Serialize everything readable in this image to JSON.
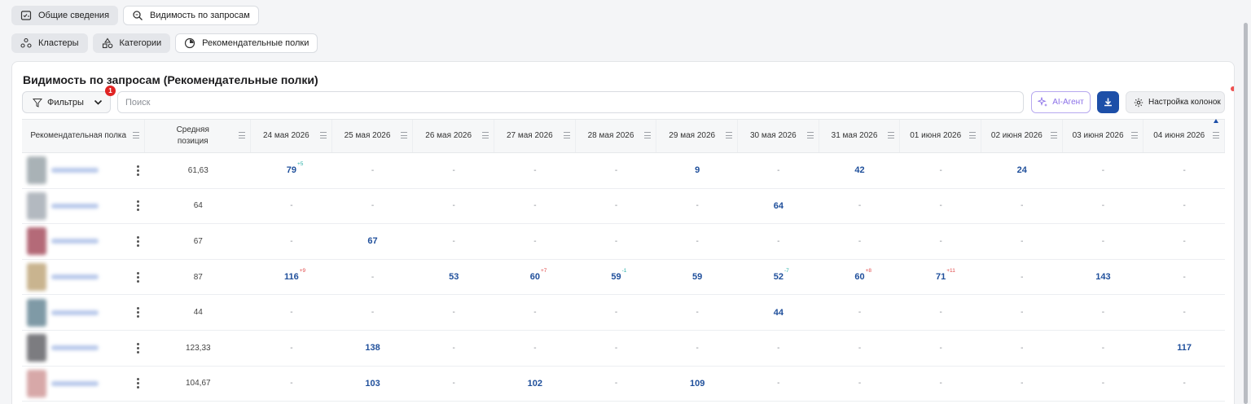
{
  "tabs_row1": [
    {
      "label": "Общие сведения",
      "icon": "overview-icon",
      "active": true
    },
    {
      "label": "Видимость по запросам",
      "icon": "search-icon",
      "active": false
    }
  ],
  "tabs_row2": [
    {
      "label": "Кластеры",
      "icon": "clusters-icon",
      "active": true
    },
    {
      "label": "Категории",
      "icon": "categories-icon",
      "active": true
    },
    {
      "label": "Рекомендательные полки",
      "icon": "shelf-icon",
      "active": false
    }
  ],
  "card": {
    "title": "Видимость по запросам (Рекомендательные полки)",
    "filters_label": "Фильтры",
    "filters_badge": "1",
    "search_placeholder": "Поиск",
    "ai_label": "AI-Агент",
    "columns_label": "Настройка колонок"
  },
  "table": {
    "headers": {
      "shelf": "Рекомендательная полка",
      "avg_position_line1": "Средняя",
      "avg_position_line2": "позиция",
      "dates": [
        "24 мая 2026",
        "25 мая 2026",
        "26 мая 2026",
        "27 мая 2026",
        "28 мая 2026",
        "29 мая 2026",
        "30 мая 2026",
        "31 мая 2026",
        "01 июня 2026",
        "02 июня 2026",
        "03 июня 2026",
        "04 июня 2026"
      ]
    },
    "rows": [
      {
        "avg": "61,63",
        "thumb": "#a9b2b6",
        "cells": [
          {
            "v": "79",
            "d": "+5",
            "t": "up"
          },
          {
            "v": "-"
          },
          {
            "v": "-"
          },
          {
            "v": "-"
          },
          {
            "v": "-"
          },
          {
            "v": "9"
          },
          {
            "v": "-"
          },
          {
            "v": "42"
          },
          {
            "v": "-"
          },
          {
            "v": "24"
          },
          {
            "v": "-"
          },
          {
            "v": "-"
          }
        ]
      },
      {
        "avg": "64",
        "thumb": "#b3b9c0",
        "cells": [
          {
            "v": "-"
          },
          {
            "v": "-"
          },
          {
            "v": "-"
          },
          {
            "v": "-"
          },
          {
            "v": "-"
          },
          {
            "v": "-"
          },
          {
            "v": "64"
          },
          {
            "v": "-"
          },
          {
            "v": "-"
          },
          {
            "v": "-"
          },
          {
            "v": "-"
          },
          {
            "v": "-"
          }
        ]
      },
      {
        "avg": "67",
        "thumb": "#b46a78",
        "cells": [
          {
            "v": "-"
          },
          {
            "v": "67"
          },
          {
            "v": "-"
          },
          {
            "v": "-"
          },
          {
            "v": "-"
          },
          {
            "v": "-"
          },
          {
            "v": "-"
          },
          {
            "v": "-"
          },
          {
            "v": "-"
          },
          {
            "v": "-"
          },
          {
            "v": "-"
          },
          {
            "v": "-"
          }
        ]
      },
      {
        "avg": "87",
        "thumb": "#c9b48f",
        "cells": [
          {
            "v": "116",
            "d": "+9",
            "t": "down"
          },
          {
            "v": "-"
          },
          {
            "v": "53"
          },
          {
            "v": "60",
            "d": "+7",
            "t": "down"
          },
          {
            "v": "59",
            "d": "-1",
            "t": "up"
          },
          {
            "v": "59"
          },
          {
            "v": "52",
            "d": "-7",
            "t": "up"
          },
          {
            "v": "60",
            "d": "+8",
            "t": "down"
          },
          {
            "v": "71",
            "d": "+11",
            "t": "down"
          },
          {
            "v": "-"
          },
          {
            "v": "143"
          },
          {
            "v": "-"
          }
        ]
      },
      {
        "avg": "44",
        "thumb": "#7f9aa6",
        "cells": [
          {
            "v": "-"
          },
          {
            "v": "-"
          },
          {
            "v": "-"
          },
          {
            "v": "-"
          },
          {
            "v": "-"
          },
          {
            "v": "-"
          },
          {
            "v": "44"
          },
          {
            "v": "-"
          },
          {
            "v": "-"
          },
          {
            "v": "-"
          },
          {
            "v": "-"
          },
          {
            "v": "-"
          }
        ]
      },
      {
        "avg": "123,33",
        "thumb": "#7c7c80",
        "cells": [
          {
            "v": "-"
          },
          {
            "v": "138"
          },
          {
            "v": "-"
          },
          {
            "v": "-"
          },
          {
            "v": "-"
          },
          {
            "v": "-"
          },
          {
            "v": "-"
          },
          {
            "v": "-"
          },
          {
            "v": "-"
          },
          {
            "v": "-"
          },
          {
            "v": "-"
          },
          {
            "v": "117"
          }
        ]
      },
      {
        "avg": "104,67",
        "thumb": "#d7a8a8",
        "cells": [
          {
            "v": "-"
          },
          {
            "v": "103"
          },
          {
            "v": "-"
          },
          {
            "v": "102"
          },
          {
            "v": "-"
          },
          {
            "v": "109"
          },
          {
            "v": "-"
          },
          {
            "v": "-"
          },
          {
            "v": "-"
          },
          {
            "v": "-"
          },
          {
            "v": "-"
          },
          {
            "v": "-"
          }
        ]
      }
    ]
  }
}
